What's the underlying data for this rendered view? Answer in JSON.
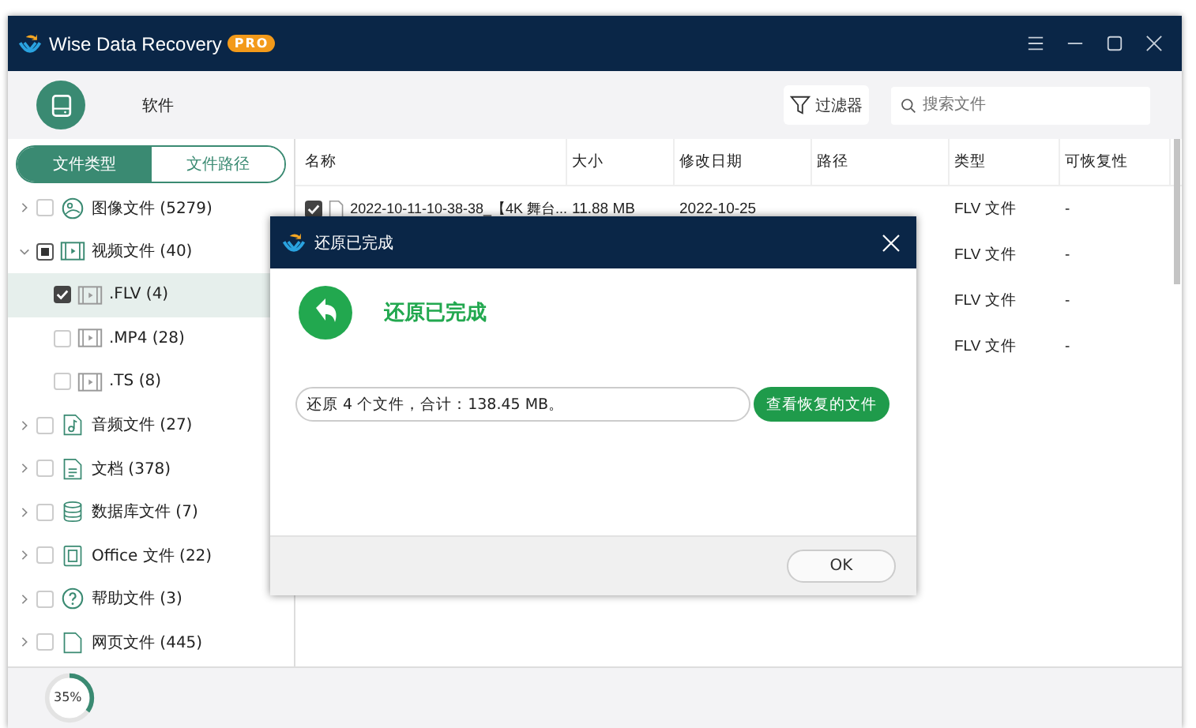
{
  "window": {
    "title": "Wise Data Recovery",
    "badge": "PRO"
  },
  "toolbar": {
    "drive_label": "软件",
    "filter_button": "过滤器",
    "search": {
      "placeholder": "搜索文件"
    }
  },
  "sidebar": {
    "tabs": [
      {
        "label": "文件类型",
        "selected": true
      },
      {
        "label": "文件路径",
        "selected": false
      }
    ],
    "tree": [
      {
        "kind": "image",
        "label": "图像文件 (5279)",
        "expanded": false,
        "checked": false,
        "indeterminate": false,
        "selected": false
      },
      {
        "kind": "video",
        "label": "视频文件 (40)",
        "expanded": true,
        "checked": false,
        "indeterminate": true,
        "selected": false,
        "children": [
          {
            "kind": "video",
            "label": ".FLV (4)",
            "checked": true,
            "indeterminate": false,
            "selected": true
          },
          {
            "kind": "video",
            "label": ".MP4 (28)",
            "checked": false,
            "indeterminate": false,
            "selected": false
          },
          {
            "kind": "video",
            "label": ".TS (8)",
            "checked": false,
            "indeterminate": false,
            "selected": false
          }
        ]
      },
      {
        "kind": "audio",
        "label": "音频文件 (27)",
        "expanded": false,
        "checked": false,
        "indeterminate": false,
        "selected": false
      },
      {
        "kind": "document",
        "label": "文档 (378)",
        "expanded": false,
        "checked": false,
        "indeterminate": false,
        "selected": false
      },
      {
        "kind": "database",
        "label": "数据库文件 (7)",
        "expanded": false,
        "checked": false,
        "indeterminate": false,
        "selected": false
      },
      {
        "kind": "office",
        "label": "Office 文件 (22)",
        "expanded": false,
        "checked": false,
        "indeterminate": false,
        "selected": false
      },
      {
        "kind": "help",
        "label": "帮助文件 (3)",
        "expanded": false,
        "checked": false,
        "indeterminate": false,
        "selected": false
      },
      {
        "kind": "web",
        "label": "网页文件 (445)",
        "expanded": false,
        "checked": false,
        "indeterminate": false,
        "selected": false
      }
    ]
  },
  "table": {
    "columns": [
      "名称",
      "大小",
      "修改日期",
      "路径",
      "类型",
      "可恢复性"
    ],
    "rows": [
      {
        "checked": true,
        "name": "2022-10-11-10-38-38_【4K 舞台...",
        "size": "11.88 MB",
        "date": "2022-10-25",
        "type": "FLV 文件",
        "recoverability": "-"
      },
      {
        "type": "FLV 文件",
        "recoverability": "-"
      },
      {
        "type": "FLV 文件",
        "recoverability": "-"
      },
      {
        "type": "FLV 文件",
        "recoverability": "-"
      }
    ]
  },
  "progress": {
    "level": 0.35,
    "reading": "35%"
  },
  "dialog": {
    "title": "还原已完成",
    "heading": "还原已完成",
    "summary": "还原 4 个文件，合计：138.45 MB。",
    "view_button": "查看恢复的文件",
    "ok_button": "OK"
  }
}
